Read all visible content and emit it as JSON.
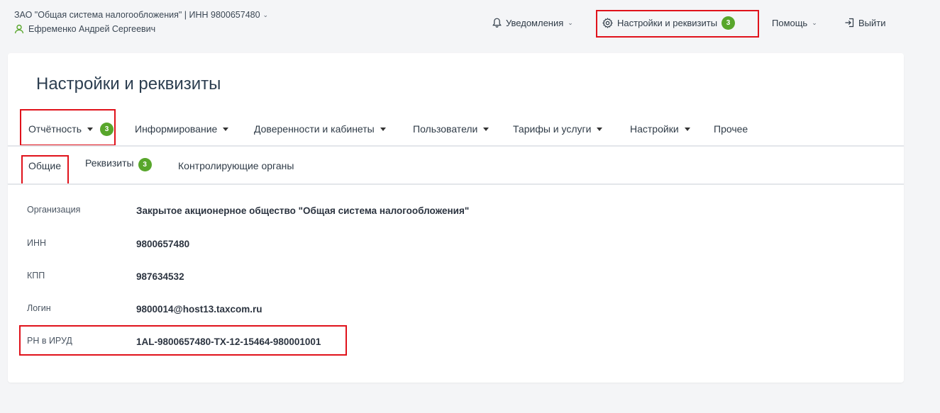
{
  "header": {
    "org": "ЗАО \"Общая система налогообложения\" | ИНН 9800657480",
    "user": "Ефременко Андрей Сергеевич",
    "notifications_label": "Уведомления",
    "settings_label": "Настройки и реквизиты",
    "settings_badge": "3",
    "help_label": "Помощь",
    "logout_label": "Выйти"
  },
  "page": {
    "title": "Настройки и реквизиты"
  },
  "main_tabs": [
    {
      "label": "Отчётность",
      "badge": "3"
    },
    {
      "label": "Информирование"
    },
    {
      "label": "Доверенности и кабинеты"
    },
    {
      "label": "Пользователи"
    },
    {
      "label": "Тарифы и услуги"
    },
    {
      "label": "Настройки"
    },
    {
      "label": "Прочее"
    }
  ],
  "sub_tabs": [
    {
      "label": "Общие"
    },
    {
      "label": "Реквизиты",
      "badge": "3"
    },
    {
      "label": "Контролирующие органы"
    }
  ],
  "fields": [
    {
      "label": "Организация",
      "value": "Закрытое акционерное общество \"Общая система налогообложения\""
    },
    {
      "label": "ИНН",
      "value": "9800657480"
    },
    {
      "label": "КПП",
      "value": "987634532"
    },
    {
      "label": "Логин",
      "value": "9800014@host13.taxcom.ru"
    },
    {
      "label": "РН в ИРУД",
      "value": "1AL-9800657480-TX-12-15464-980001001"
    }
  ],
  "colors": {
    "badge": "#58a62b",
    "highlight": "#e0121b",
    "user_icon": "#58a62b"
  }
}
